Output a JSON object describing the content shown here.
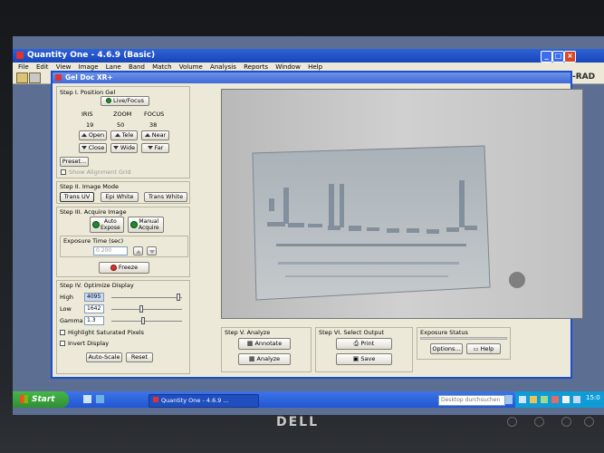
{
  "app": {
    "title": "Quantity One - 4.6.9 (Basic)",
    "brand_fragment": "-RAD",
    "menu": [
      "File",
      "Edit",
      "View",
      "Image",
      "Lane",
      "Band",
      "Match",
      "Volume",
      "Analysis",
      "Reports",
      "Window",
      "Help"
    ]
  },
  "child": {
    "title": "Gel Doc XR+",
    "step1": {
      "title": "Step I. Position Gel",
      "live_focus": "Live/Focus",
      "iris_label": "IRIS",
      "zoom_label": "ZOOM",
      "focus_label": "FOCUS",
      "iris_value": "19",
      "zoom_value": "50",
      "focus_value": "38",
      "open": "Open",
      "close": "Close",
      "tele": "Tele",
      "wide": "Wide",
      "near": "Near",
      "far": "Far",
      "preset": "Preset...",
      "show_grid": "Show Alignment Grid"
    },
    "step2": {
      "title": "Step II. Image Mode",
      "trans_uv": "Trans UV",
      "epi_white": "Epi White",
      "trans_white": "Trans White"
    },
    "step3": {
      "title": "Step III. Acquire Image",
      "auto_expose": "Auto\nExpose",
      "manual_acquire": "Manual\nAcquire",
      "exposure_label": "Exposure Time (sec)",
      "exposure_value": "0.200",
      "freeze": "Freeze"
    },
    "step4": {
      "title": "Step IV. Optimize Display",
      "high_label": "High",
      "high_value": "4095",
      "low_label": "Low",
      "low_value": "1642",
      "gamma_label": "Gamma",
      "gamma_value": "1.3",
      "highlight_saturated": "Highlight Saturated Pixels",
      "invert_display": "Invert Display",
      "auto_scale": "Auto-Scale",
      "reset": "Reset",
      "high_level": 0.97,
      "low_level": 0.42,
      "gamma_level": 0.45
    },
    "step5": {
      "title": "Step V. Analyze",
      "annotate": "Annotate",
      "analyze": "Analyze"
    },
    "step6": {
      "title": "Step VI. Select Output",
      "print": "Print",
      "save": "Save"
    },
    "exposure_status": {
      "title": "Exposure Status",
      "options": "Options...",
      "help": "Help"
    }
  },
  "taskbar": {
    "start": "Start",
    "task_item": "Quantity One - 4.6.9 ...",
    "desktop_search": "Desktop durchsuchen",
    "clock": "15:0"
  },
  "monitor_brand": "DELL",
  "colors": {
    "xp_blue": "#1c4fcf",
    "start_green": "#3aa33f",
    "freeze_red": "#d8342a"
  }
}
